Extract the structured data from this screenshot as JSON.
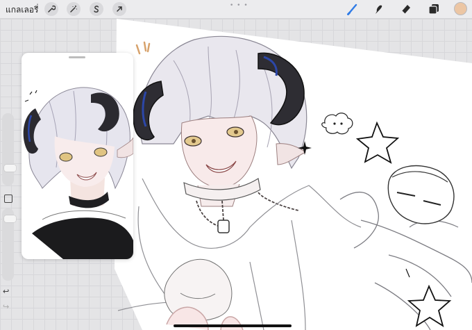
{
  "toolbar": {
    "gallery_label": "แกลเลอรี่",
    "left_tools": [
      {
        "name": "wrench-icon"
      },
      {
        "name": "adjustments-wand-icon"
      },
      {
        "name": "selection-s-icon"
      },
      {
        "name": "transform-arrow-icon"
      }
    ],
    "grip": "• • •",
    "right_tools": [
      {
        "name": "brush-icon",
        "active": true
      },
      {
        "name": "smudge-icon"
      },
      {
        "name": "eraser-icon"
      },
      {
        "name": "layers-icon"
      }
    ],
    "current_color": "#ecc6a4",
    "active_tool_color": "#2f7be6"
  },
  "sidebar": {
    "brush_size_level": 0.35,
    "opacity_level": 0.55,
    "undo": "↩",
    "redo": "↪"
  },
  "reference_window": {
    "content": "reference-image"
  }
}
